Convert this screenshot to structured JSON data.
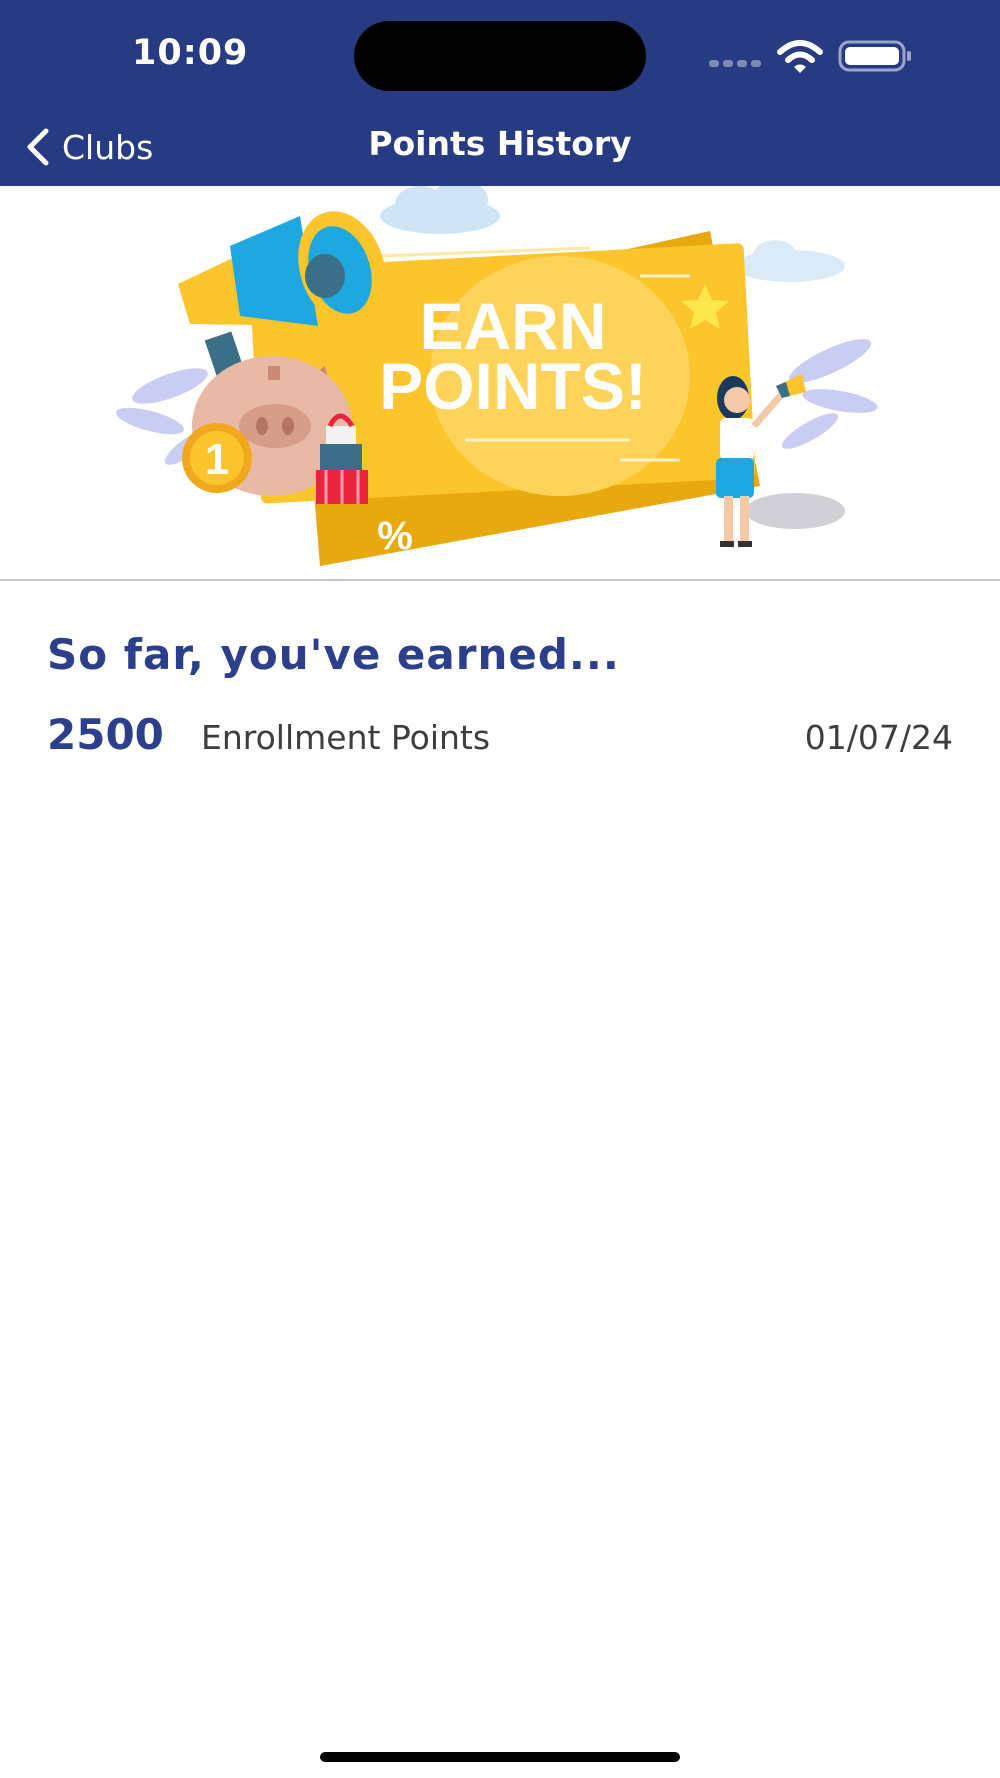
{
  "status_bar": {
    "time": "10:09"
  },
  "nav": {
    "back_label": "Clubs",
    "title": "Points History"
  },
  "banner": {
    "line1": "EARN",
    "line2": "POINTS!",
    "coin": "1",
    "percent": "%"
  },
  "history": {
    "heading": "So far, you've earned...",
    "items": [
      {
        "points": "2500",
        "description": "Enrollment Points",
        "date": "01/07/24"
      }
    ]
  },
  "colors": {
    "header": "#263b82",
    "accent": "#2b3f8c",
    "banner_yellow": "#fdc52c"
  }
}
